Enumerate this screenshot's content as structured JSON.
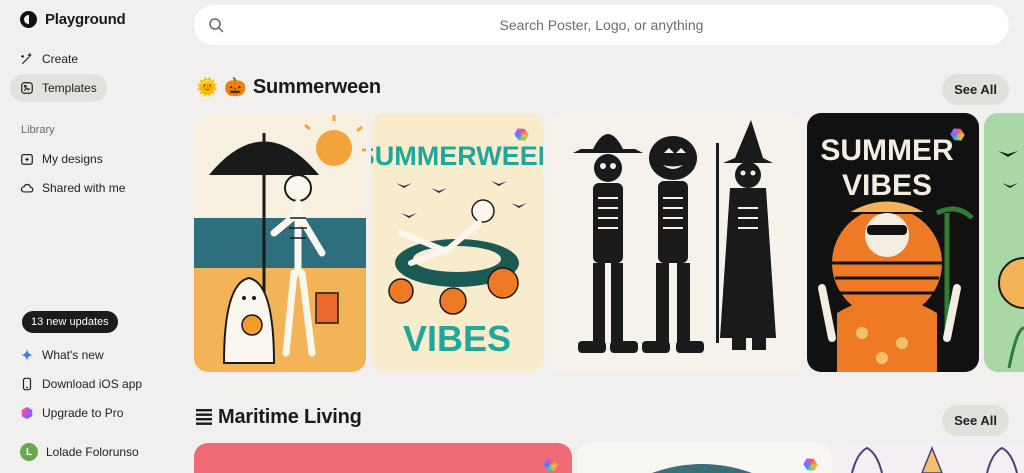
{
  "app": {
    "name": "Playground"
  },
  "sidebar": {
    "nav": [
      {
        "label": "Create",
        "icon": "wand-icon"
      },
      {
        "label": "Templates",
        "icon": "templates-icon",
        "active": true
      }
    ],
    "library_label": "Library",
    "library": [
      {
        "label": "My designs",
        "icon": "folder-icon"
      },
      {
        "label": "Shared with me",
        "icon": "cloud-icon"
      }
    ],
    "updates_pill": "13 new updates",
    "footer": [
      {
        "label": "What's new",
        "icon": "sparkle-icon"
      },
      {
        "label": "Download iOS app",
        "icon": "phone-icon"
      },
      {
        "label": "Upgrade to Pro",
        "icon": "pro-icon"
      }
    ],
    "user": {
      "initial": "L",
      "name": "Lolade Folorunso"
    }
  },
  "search": {
    "placeholder": "Search Poster, Logo, or anything"
  },
  "sections": [
    {
      "title": "Summerween",
      "emoji": [
        "🌞",
        "🎃"
      ],
      "see_all": "See All",
      "cards": [
        {
          "name": "beach-skeleton-umbrella",
          "bg": "#f4b563"
        },
        {
          "name": "summerween-vibes",
          "text_top": "SUMMERWEEN",
          "text_bottom": "VIBES",
          "bg": "#f8eccd",
          "accent": "#1ea79a"
        },
        {
          "name": "three-skeletons",
          "bg": "#f6f0ea"
        },
        {
          "name": "summer-vibes-skeleton",
          "text": "SUMMER VIBES",
          "bg": "#111111"
        },
        {
          "name": "green-bats",
          "bg": "#a9d7a6"
        }
      ]
    },
    {
      "title": "Maritime Living",
      "see_all": "See All",
      "cards": [
        {
          "name": "maritime-pink",
          "bg": "#f06070"
        },
        {
          "name": "maritime-white",
          "bg": "#f7f5f2"
        },
        {
          "name": "maritime-lobsters",
          "bg": "#f5f0f3"
        }
      ]
    }
  ]
}
